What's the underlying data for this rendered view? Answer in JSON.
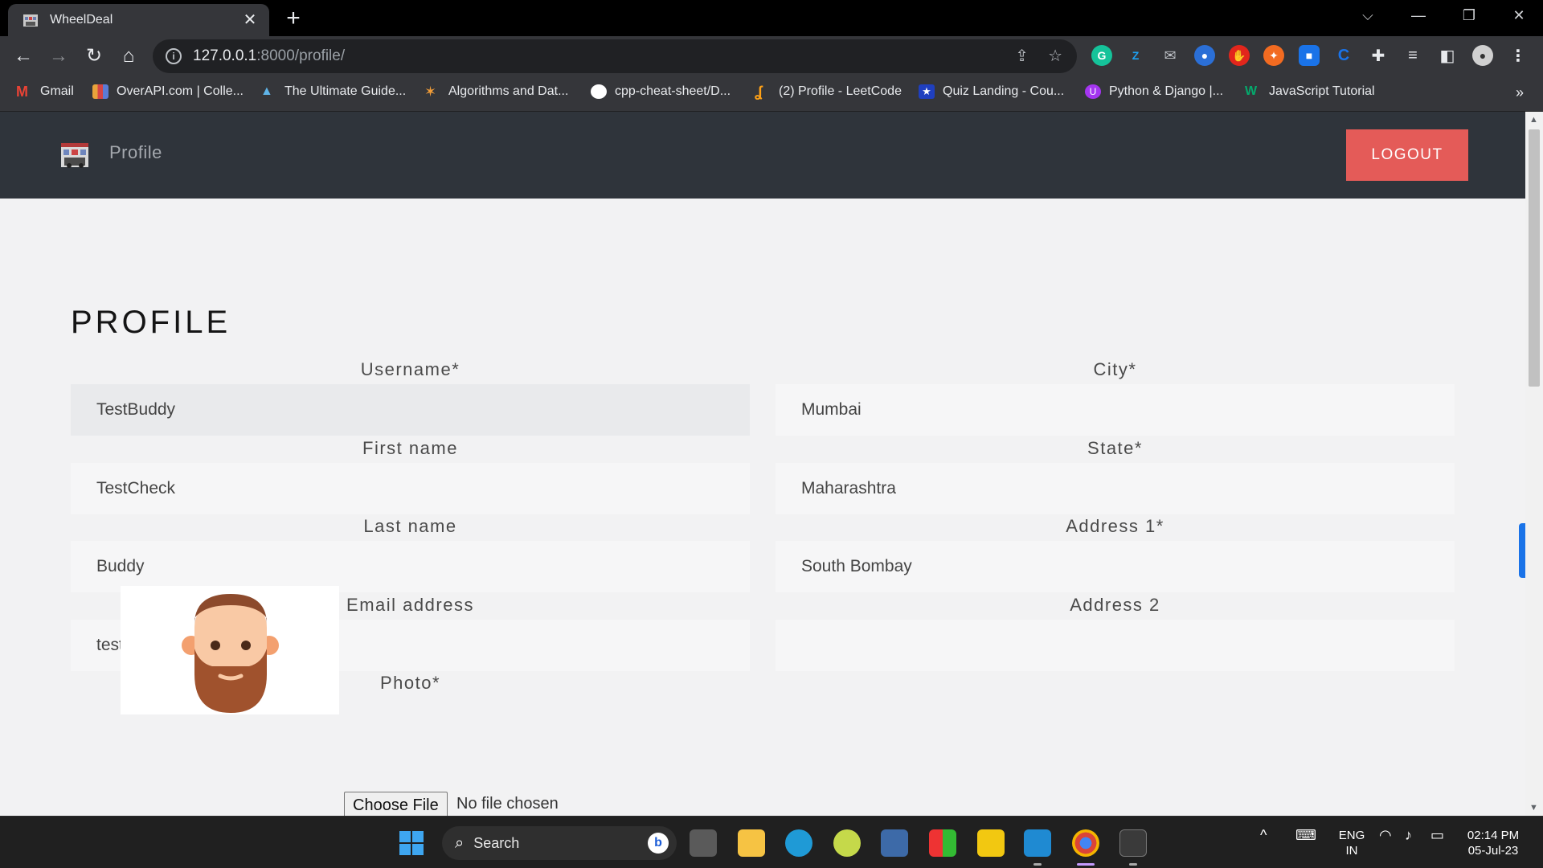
{
  "browser": {
    "tab_title": "WheelDeal",
    "tab_close": "✕",
    "new_tab": "+",
    "window_controls": {
      "dropdown": "⌵",
      "minimize": "—",
      "restore": "❐",
      "close": "✕"
    },
    "url_host": "127.0.0.1",
    "url_path": ":8000/profile/",
    "bookmarks": [
      {
        "label": "Gmail",
        "icon": "gmail-icon",
        "color": "#ea4335"
      },
      {
        "label": "OverAPI.com | Colle...",
        "icon": "overapi-icon",
        "color": "#e8a33b"
      },
      {
        "label": "The Ultimate Guide...",
        "icon": "mountain-icon",
        "color": "#5fb4e8"
      },
      {
        "label": "Algorithms and Dat...",
        "icon": "algo-icon",
        "color": "#f29d38"
      },
      {
        "label": "cpp-cheat-sheet/D...",
        "icon": "github-icon",
        "color": "#ffffff"
      },
      {
        "label": "(2) Profile - LeetCode",
        "icon": "leetcode-icon",
        "color": "#ffa116"
      },
      {
        "label": "Quiz Landing - Cou...",
        "icon": "star-icon",
        "color": "#1f3fbf"
      },
      {
        "label": "Python & Django |...",
        "icon": "udemy-icon",
        "color": "#a435f0"
      },
      {
        "label": "JavaScript Tutorial",
        "icon": "w3-icon",
        "color": "#04aa6d"
      }
    ],
    "bookmarks_more": "»"
  },
  "site": {
    "nav_title": "Profile",
    "logout_label": "LOGOUT",
    "heading": "PROFILE",
    "fields_left": [
      {
        "label": "Username*",
        "value": "TestBuddy"
      },
      {
        "label": "First name",
        "value": "TestCheck"
      },
      {
        "label": "Last name",
        "value": "Buddy"
      },
      {
        "label": "Email address",
        "value": "testbuddy@gmail.com"
      }
    ],
    "fields_right": [
      {
        "label": "City*",
        "value": "Mumbai"
      },
      {
        "label": "State*",
        "value": "Maharashtra"
      },
      {
        "label": "Address 1*",
        "value": "South Bombay"
      },
      {
        "label": "Address 2",
        "value": ""
      }
    ],
    "photo_label": "Photo*",
    "file_button": "Choose File",
    "file_status": "No file chosen",
    "accent": "#e45b58"
  },
  "taskbar": {
    "search_label": "Search",
    "language": "ENG",
    "region": "IN",
    "time": "02:14 PM",
    "date": "05-Jul-23"
  }
}
